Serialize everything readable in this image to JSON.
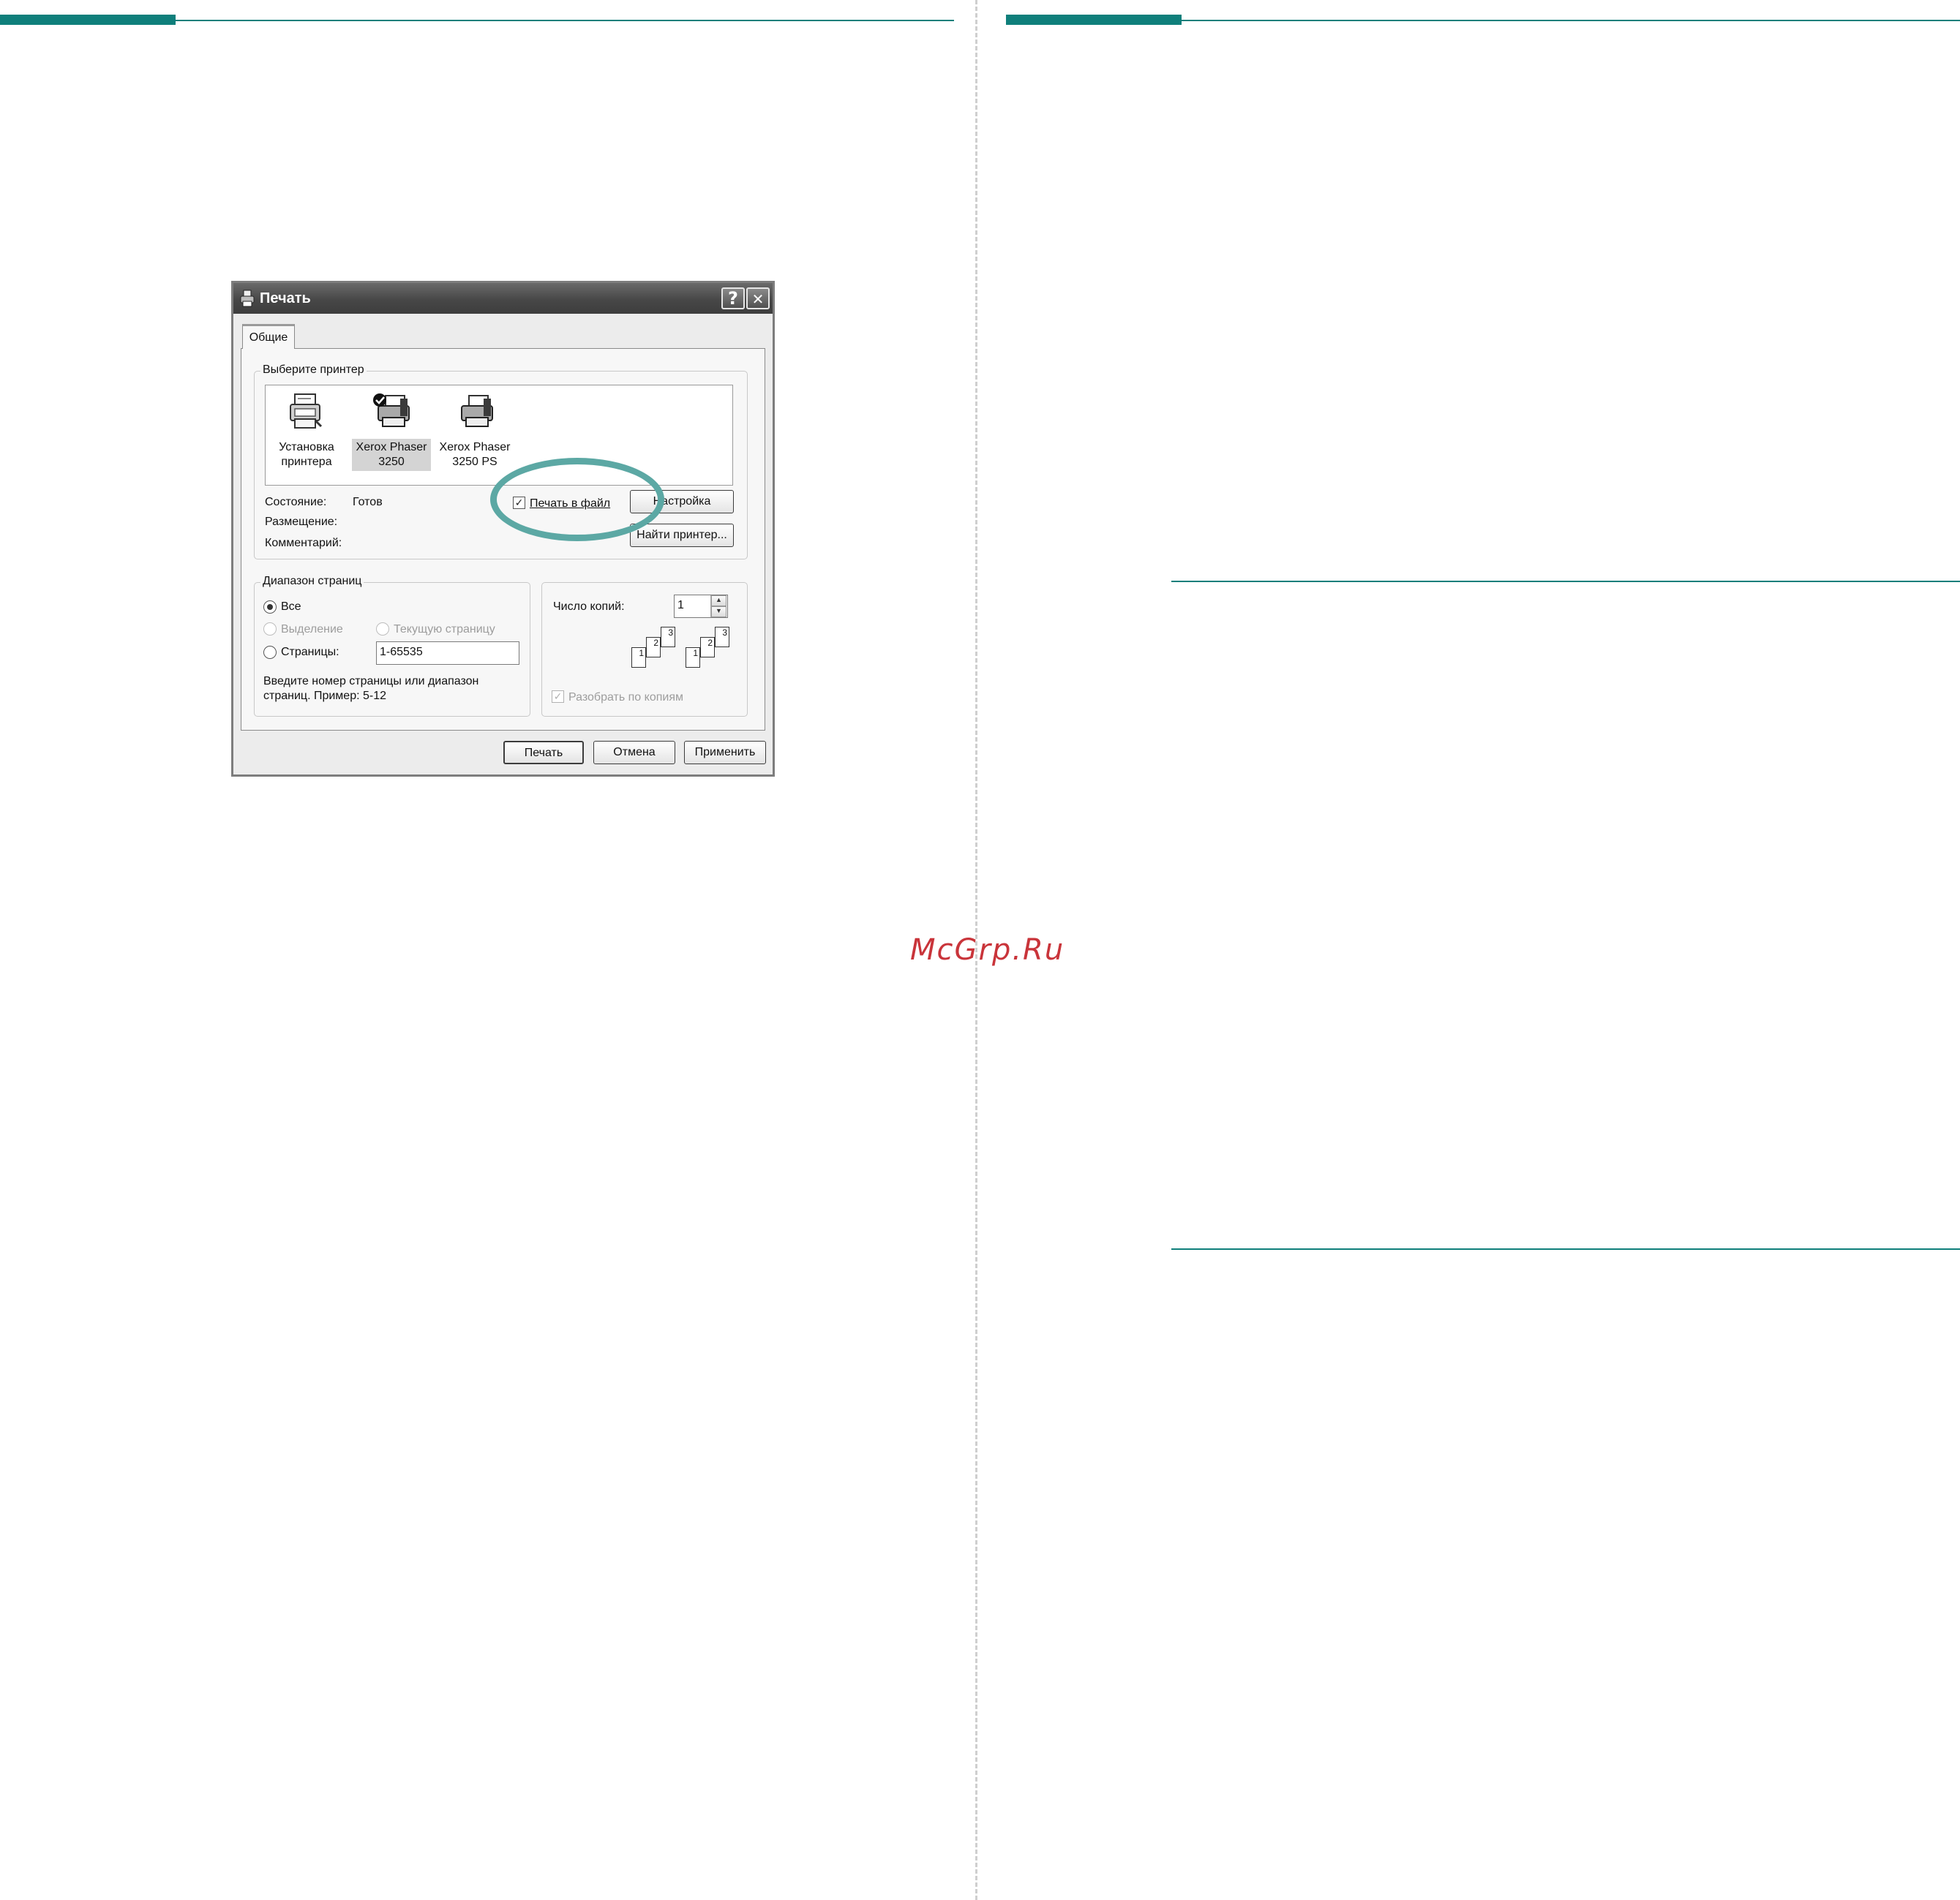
{
  "watermark": "McGrp.Ru",
  "dialog": {
    "title": "Печать",
    "help_button": "?",
    "close_button": "✕",
    "tab_general": "Общие",
    "select_printer": {
      "legend": "Выберите принтер",
      "printers": [
        {
          "line1": "Установка",
          "line2": "принтера"
        },
        {
          "line1": "Xerox Phaser",
          "line2": "3250"
        },
        {
          "line1": "Xerox Phaser",
          "line2": "3250 PS"
        }
      ],
      "status_label": "Состояние:",
      "status_value": "Готов",
      "location_label": "Размещение:",
      "comment_label": "Комментарий:",
      "print_to_file_label": "Печать в файл",
      "settings_button": "Настройка",
      "find_printer_button": "Найти принтер..."
    },
    "page_range": {
      "legend": "Диапазон страниц",
      "all_label": "Все",
      "selection_label": "Выделение",
      "current_page_label": "Текущую страницу",
      "pages_label": "Страницы:",
      "pages_value": "1-65535",
      "hint_line1": "Введите номер страницы или диапазон",
      "hint_line2": "страниц.  Пример: 5-12"
    },
    "copies": {
      "count_label": "Число копий:",
      "count_value": "1",
      "collate_label": "Разобрать по копиям",
      "sheet_numbers": [
        "1",
        "2",
        "3"
      ]
    },
    "buttons": {
      "print": "Печать",
      "cancel": "Отмена",
      "apply": "Применить"
    }
  }
}
